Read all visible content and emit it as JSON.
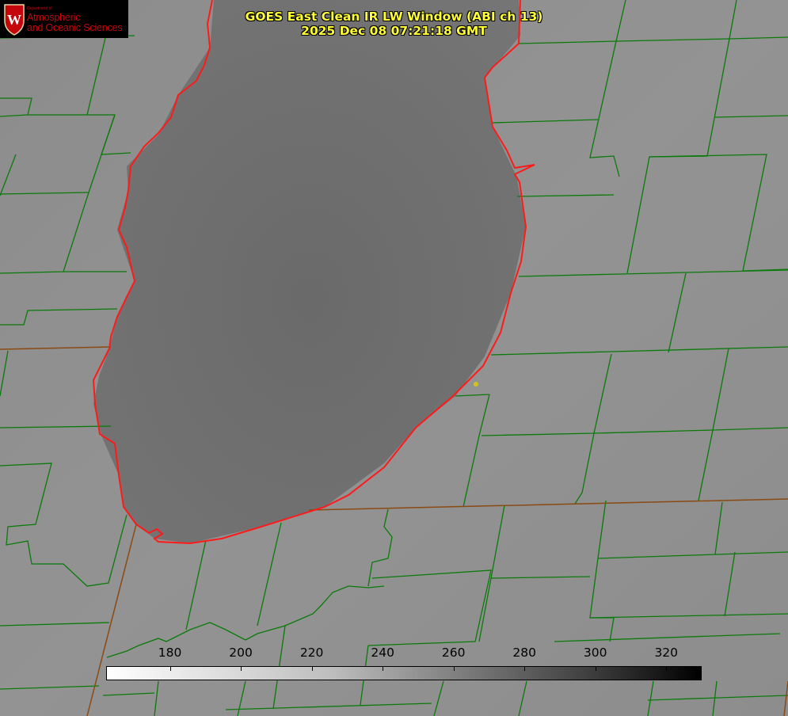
{
  "logo": {
    "dept_small": "Department of",
    "line1": "Atmospheric",
    "line2": "and Oceanic Sciences",
    "badge_letter": "W"
  },
  "title": {
    "line1": "GOES East Clean IR LW Window (ABI ch 13)",
    "line2": "2025 Dec 08 07:21:18 GMT"
  },
  "colorbar": {
    "ticks": [
      "180",
      "200",
      "220",
      "240",
      "260",
      "280",
      "300",
      "320"
    ],
    "range_min": 162,
    "range_max": 330,
    "gradient": "white-to-black"
  },
  "colors": {
    "land_gray": "#8f8f8f",
    "lake_gray": "#6d6d6d",
    "county_lines": "#0a7a0a",
    "state_lines": "#8a4a12",
    "lake_outline": "#ff0000",
    "title_text": "#ffff33",
    "logo_red": "#c5050c"
  },
  "map_features": [
    "lake-outline",
    "county-boundaries",
    "state-boundaries",
    "station-marker"
  ]
}
